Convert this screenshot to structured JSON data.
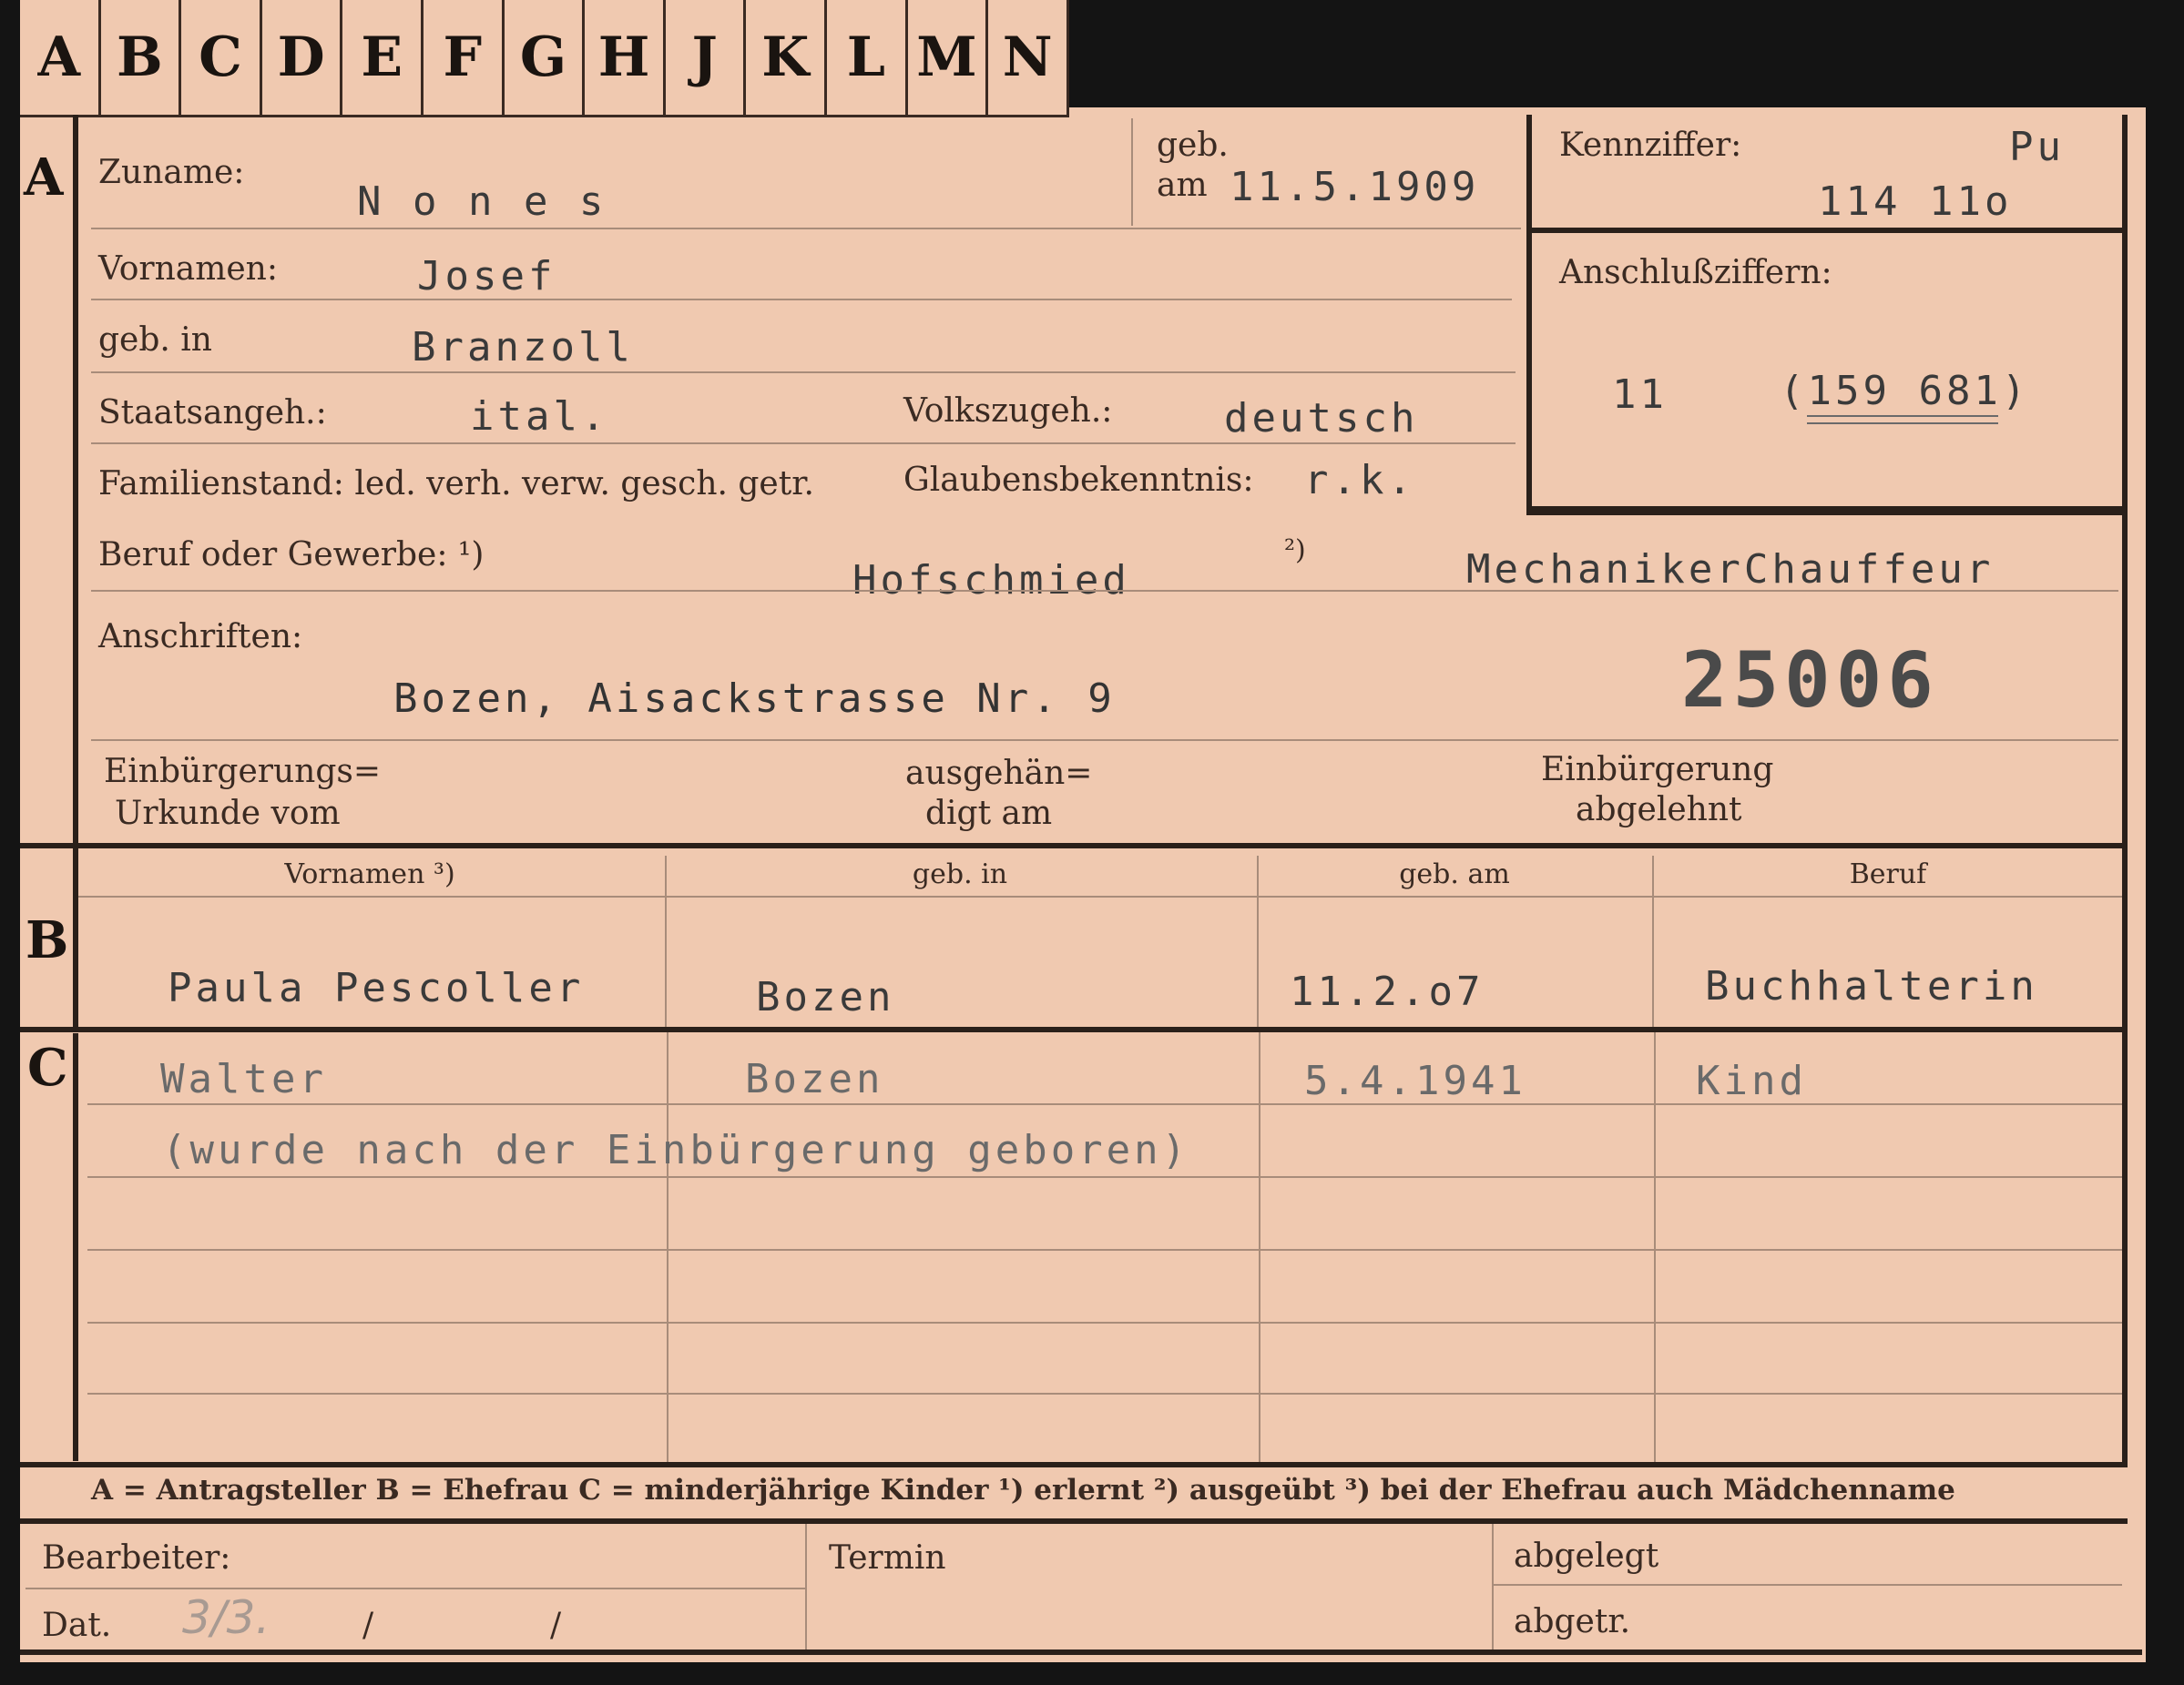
{
  "tabs": [
    "A",
    "B",
    "C",
    "D",
    "E",
    "F",
    "G",
    "H",
    "J",
    "K",
    "L",
    "M",
    "N"
  ],
  "section_a": {
    "letter": "A",
    "surname_label": "Zuname:",
    "surname_value": "N o n e s",
    "born_label_1": "geb.",
    "born_label_2": "am",
    "born_value": "11.5.1909",
    "key_label": "Kennziffer:",
    "key_code": "Pu",
    "key_value": "114 11o",
    "connection_label": "Anschlußziffern:",
    "connection_value_1": "11",
    "connection_value_2": "(159 681)",
    "firstname_label": "Vornamen:",
    "firstname_value": "Josef",
    "birthplace_label": "geb. in",
    "birthplace_value": "Branzoll",
    "citizenship_label": "Staatsangeh.:",
    "citizenship_value": "ital.",
    "ethnicity_label": "Volkszugeh.:",
    "ethnicity_value": "deutsch",
    "marital_label": "Familienstand: led. verh. verw. gesch. getr.",
    "religion_label": "Glaubensbekenntnis:",
    "religion_value": "r.k.",
    "profession_label": "Beruf oder Gewerbe: ¹)",
    "profession_value": "Hofschmied",
    "profession_note2": "²)",
    "profession_value_2": "MechanikerChauffeur",
    "address_label": "Anschriften:",
    "address_value": "Bozen, Aisackstrasse Nr. 9",
    "stamp_number": "25006",
    "naturalization_doc_label_1": "Einbürgerungs=",
    "naturalization_doc_label_2": "Urkunde vom",
    "handed_label_1": "ausgehän=",
    "handed_label_2": "digt am",
    "naturalization_denied_1": "Einbürgerung",
    "naturalization_denied_2": "abgelehnt"
  },
  "section_b": {
    "letter": "B",
    "headers": [
      "Vornamen ³)",
      "geb. in",
      "geb. am",
      "Beruf"
    ],
    "row": [
      "Paula Pescoller",
      "Bozen",
      "11.2.o7",
      "Buchhalterin"
    ]
  },
  "section_c": {
    "letter": "C",
    "row1": [
      "Walter",
      "Bozen",
      "5.4.1941",
      "Kind"
    ],
    "note": "(wurde nach der Einbürgerung geboren)"
  },
  "legend": "A = Antragsteller   B = Ehefrau   C = minderjährige Kinder   ¹) erlernt   ²) ausgeübt   ³) bei der Ehefrau auch Mädchenname",
  "footer": {
    "clerk_label": "Bearbeiter:",
    "date_label": "Dat.",
    "date_value": "3/3.",
    "date_slash_1": "/",
    "date_slash_2": "/",
    "deadline_label": "Termin",
    "filed_label": "abgelegt",
    "removed_label": "abgetr."
  }
}
